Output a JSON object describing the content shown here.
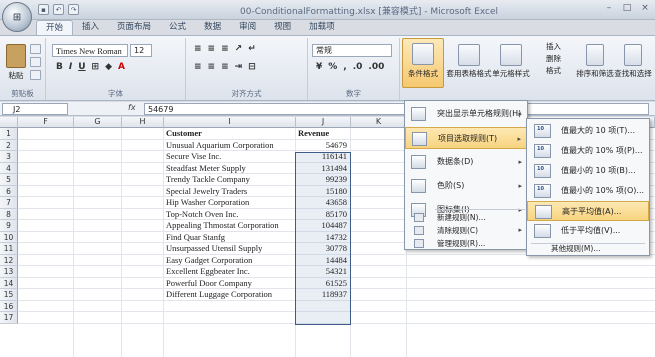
{
  "window": {
    "title": "00-ConditionalFormatting.xlsx [兼容模式] - Microsoft Excel"
  },
  "ribbon": {
    "tabs": [
      "开始",
      "插入",
      "页面布局",
      "公式",
      "数据",
      "审阅",
      "视图",
      "加载项"
    ],
    "active_tab": "开始",
    "font_name": "Times New Roman",
    "font_size": "12",
    "number_format": "常规",
    "paste_label": "粘贴",
    "groups": [
      "剪贴板",
      "字体",
      "对齐方式",
      "数字"
    ],
    "cond_format_label": "条件格式",
    "table_format_label": "套用表格格式",
    "cell_style_label": "单元格样式",
    "insert_label": "插入",
    "delete_label": "删除",
    "format_label": "格式",
    "sort_filter_label": "排序和筛选",
    "find_select_label": "查找和选择"
  },
  "formula_bar": {
    "name_box": "J2",
    "fx": "fx",
    "value": "54679"
  },
  "sheet": {
    "columns": [
      "F",
      "G",
      "H",
      "I",
      "J",
      "K"
    ],
    "rows": [
      "1",
      "2",
      "3",
      "4",
      "5",
      "6",
      "7",
      "8",
      "9",
      "10",
      "11",
      "12",
      "13",
      "14",
      "15",
      "16",
      "17"
    ],
    "header_customer": "Customer",
    "header_revenue": "Revenue",
    "data": [
      {
        "customer": "Unusual Aquarium Corporation",
        "revenue": "54679"
      },
      {
        "customer": "Secure Vise Inc.",
        "revenue": "116141"
      },
      {
        "customer": "Steadfast Meter Supply",
        "revenue": "131494"
      },
      {
        "customer": "Trendy Tackle Company",
        "revenue": "99239"
      },
      {
        "customer": "Special Jewelry Traders",
        "revenue": "15180"
      },
      {
        "customer": "Hip Washer Corporation",
        "revenue": "43658"
      },
      {
        "customer": "Top-Notch Oven Inc.",
        "revenue": "85170"
      },
      {
        "customer": "Appealing Thmostat Corporation",
        "revenue": "104487"
      },
      {
        "customer": "Find Quar Stanfg",
        "revenue": "14732"
      },
      {
        "customer": "Unsurpassed Utensil Supply",
        "revenue": "30778"
      },
      {
        "customer": "Easy Gadget Corporation",
        "revenue": "14484"
      },
      {
        "customer": "Excellent Eggbeater Inc.",
        "revenue": "54321"
      },
      {
        "customer": "Powerful Door Company",
        "revenue": "61525"
      },
      {
        "customer": "Different Luggage Corporation",
        "revenue": "118937"
      }
    ]
  },
  "cf_menu": {
    "items": [
      {
        "label": "突出显示单元格规则(H)",
        "has_submenu": true
      },
      {
        "label": "项目选取规则(T)",
        "has_submenu": true,
        "highlighted": true
      },
      {
        "label": "数据条(D)",
        "has_submenu": true
      },
      {
        "label": "色阶(S)",
        "has_submenu": true
      },
      {
        "label": "图标集(I)",
        "has_submenu": true
      }
    ],
    "small_items": [
      {
        "label": "新建规则(N)..."
      },
      {
        "label": "清除规则(C)",
        "has_submenu": true
      },
      {
        "label": "管理规则(R)..."
      }
    ]
  },
  "top_bottom_submenu": {
    "items": [
      {
        "label": "值最大的 10 项(T)...",
        "icon_num": "10"
      },
      {
        "label": "值最大的 10% 项(P)...",
        "icon_num": "10"
      },
      {
        "label": "值最小的 10 项(B)...",
        "icon_num": "10"
      },
      {
        "label": "值最小的 10% 项(O)...",
        "icon_num": "10"
      },
      {
        "label": "高于平均值(A)...",
        "icon_num": "",
        "highlighted": true
      },
      {
        "label": "低于平均值(V)...",
        "icon_num": ""
      }
    ],
    "more": "其他规则(M)..."
  }
}
